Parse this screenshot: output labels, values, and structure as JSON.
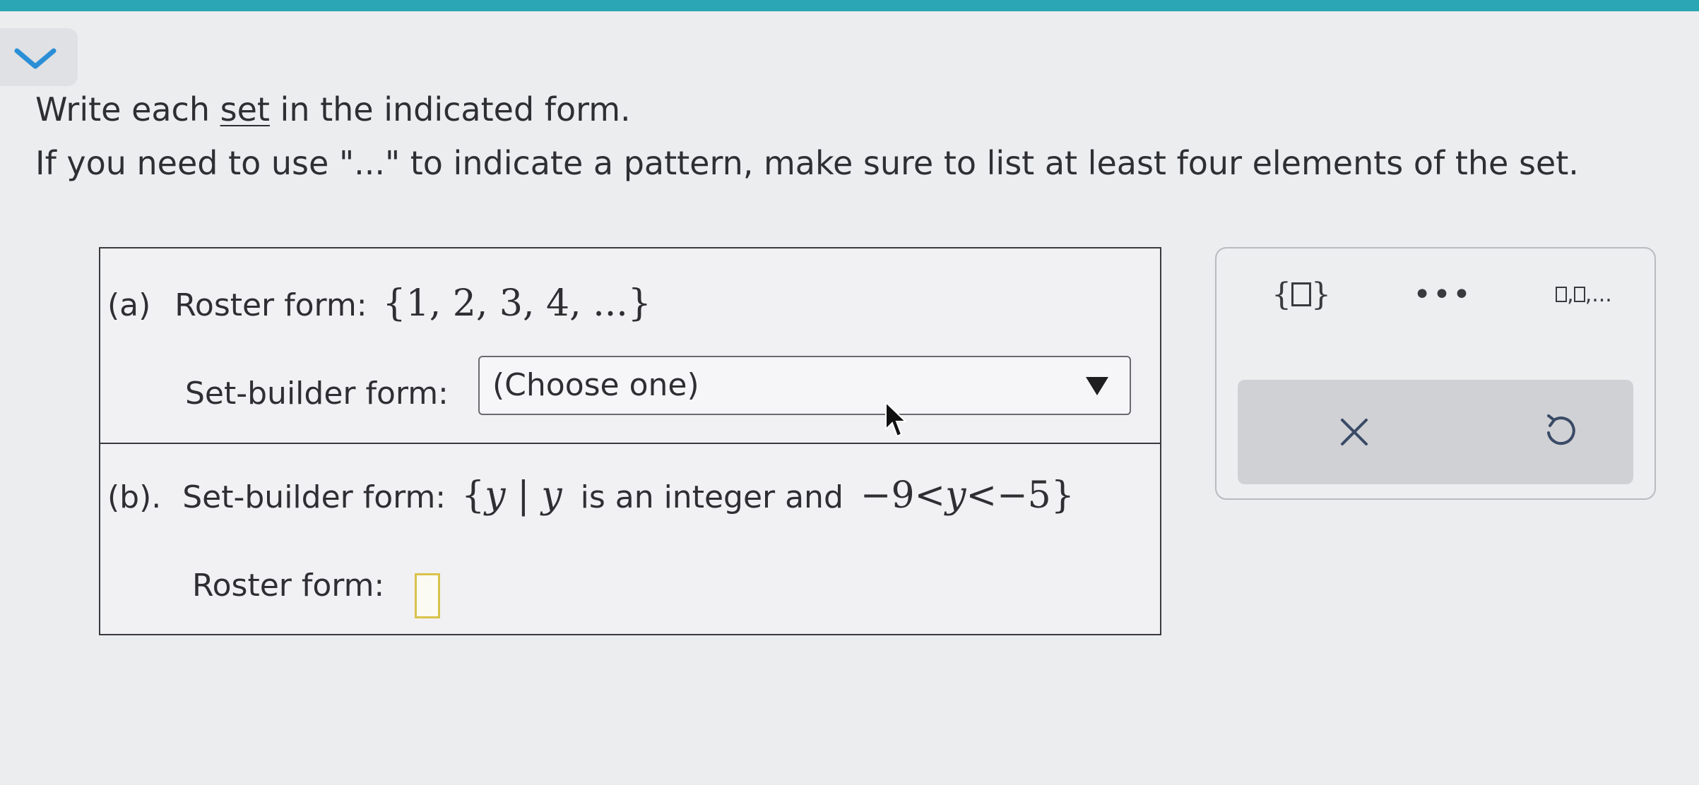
{
  "instructions": {
    "line1_before": "Write each ",
    "line1_link": "set",
    "line1_after": " in the indicated form.",
    "line2": "If you need to use \"...\" to indicate a pattern, make sure to list at least four elements of the set."
  },
  "part_a": {
    "label": "(a)",
    "roster_label": "Roster form:",
    "roster_value": "{1, 2, 3, 4, ...}",
    "setbuilder_label": "Set-builder form:",
    "select_value": "(Choose one)"
  },
  "part_b": {
    "label": "(b).",
    "setbuilder_label": "Set-builder form:",
    "setbuilder_open": "{",
    "var_y": "y",
    "bar": "|",
    "var_y2": "y",
    "condition_text": "is an integer and",
    "inequality_left": "−9<",
    "var_y3": "y",
    "inequality_right": "<−5",
    "setbuilder_close": "}",
    "roster_label": "Roster form:",
    "roster_input_value": ""
  },
  "toolbox": {
    "set_brace_open": "{",
    "set_brace_close": "}",
    "ellipsis": "•••",
    "list_sep": ",",
    "list_end": ",...",
    "clear_icon": "×",
    "undo_icon": "undo-icon"
  },
  "colors": {
    "accent_bar": "#2aa6b5",
    "input_border": "#d9c24a"
  }
}
